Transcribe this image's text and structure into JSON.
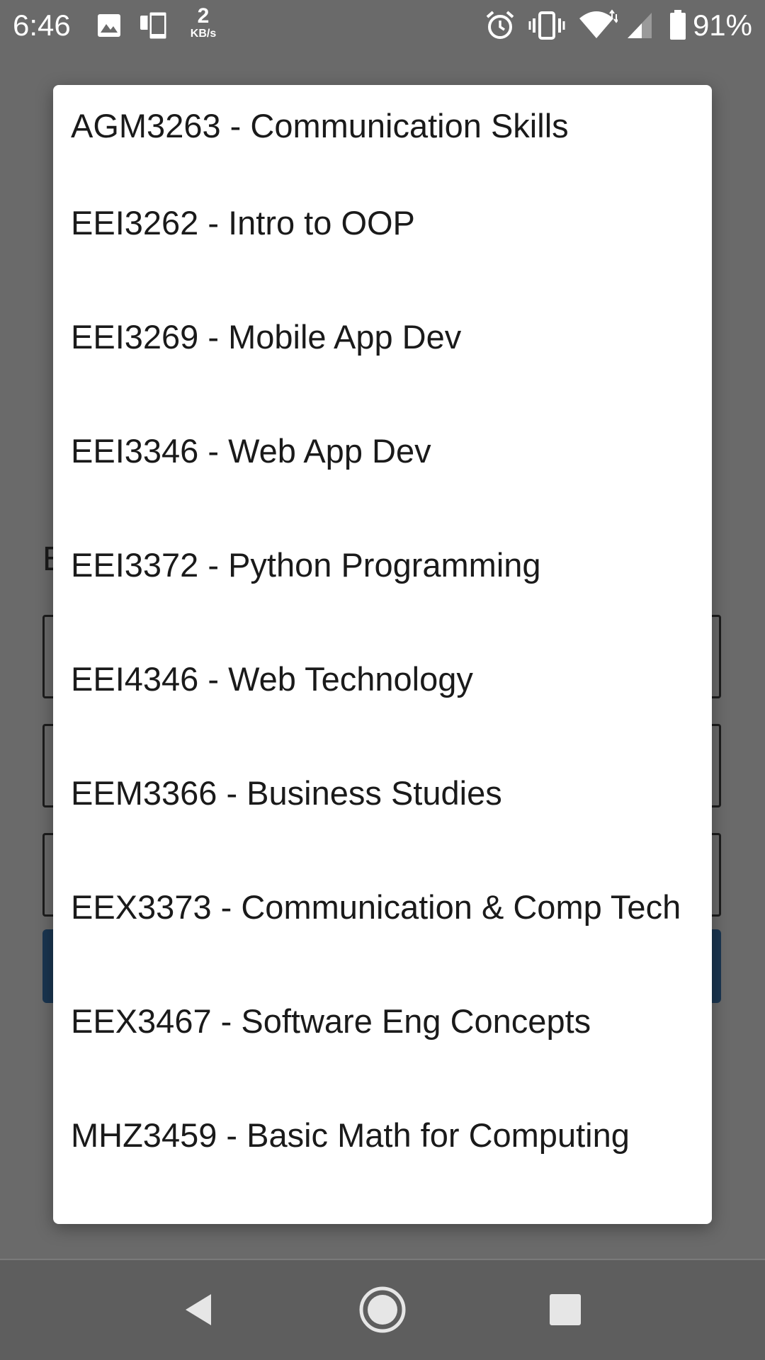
{
  "status_bar": {
    "time": "6:46",
    "data_rate_value": "2",
    "data_rate_unit": "KB/s",
    "battery_percent": "91%",
    "icons": [
      "image-icon",
      "device-icon",
      "alarm-icon",
      "vibrate-icon",
      "wifi-icon",
      "signal-icon",
      "battery-icon"
    ]
  },
  "background": {
    "heading_partial": "E"
  },
  "dialog": {
    "options": [
      "AGM3263 - Communication Skills",
      "EEI3262 - Intro to OOP",
      "EEI3269 - Mobile App Dev",
      "EEI3346 - Web App Dev",
      "EEI3372 - Python Programming",
      "EEI4346 - Web Technology",
      "EEM3366 - Business Studies",
      "EEX3373 - Communication & Comp Tech",
      "EEX3467 - Software Eng Concepts",
      "MHZ3459 - Basic Math for Computing"
    ]
  },
  "nav_bar": {
    "buttons": [
      "back-icon",
      "home-icon",
      "recents-icon"
    ]
  },
  "colors": {
    "scrim_background": "#6a6a6a",
    "dialog_background": "#ffffff",
    "text_primary": "#1a1a1a",
    "status_text": "#ffffff",
    "bg_button": "#1a3550"
  }
}
